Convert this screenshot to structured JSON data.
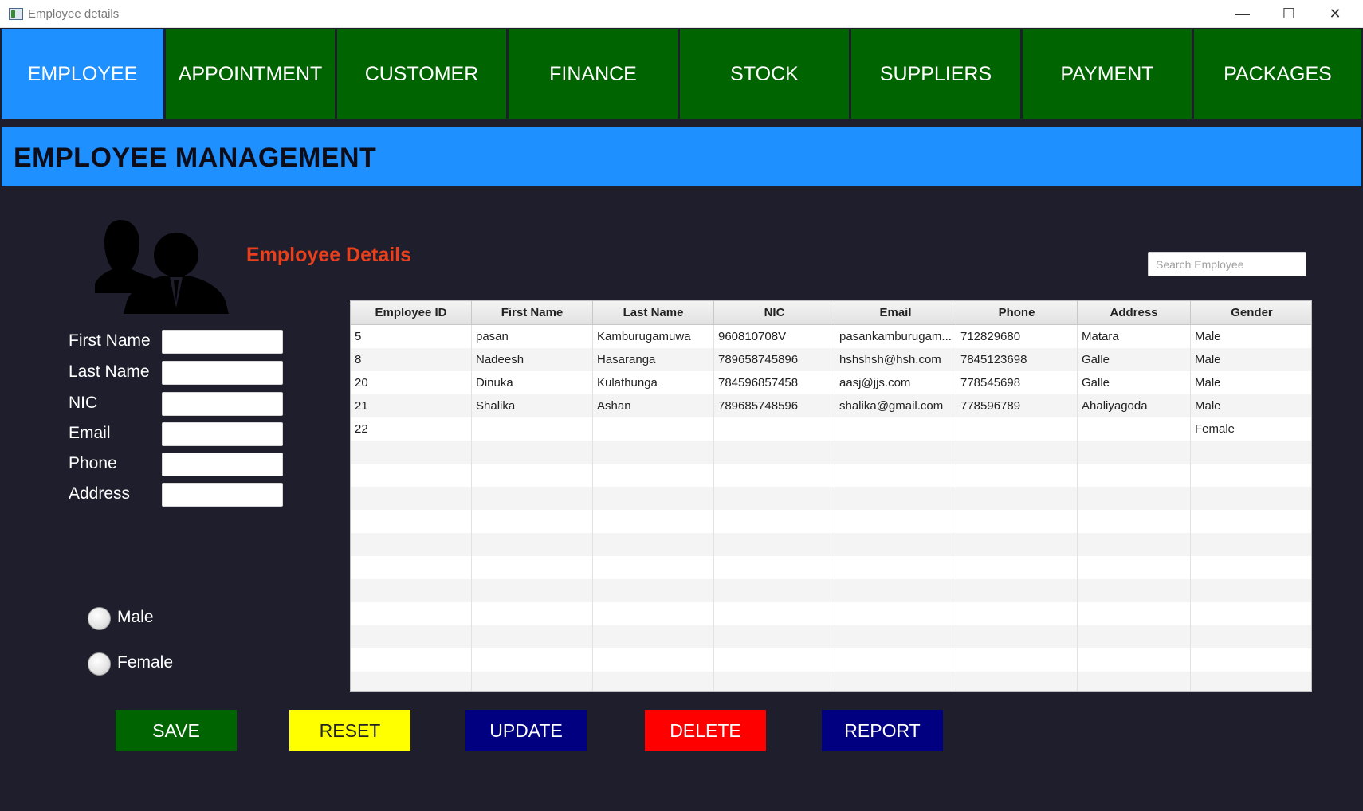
{
  "window": {
    "title": "Employee details",
    "minimize": "—",
    "maximize": "☐",
    "close": "✕"
  },
  "nav": {
    "items": [
      {
        "label": "EMPLOYEE",
        "active": true
      },
      {
        "label": "APPOINTMENT",
        "active": false
      },
      {
        "label": "CUSTOMER",
        "active": false
      },
      {
        "label": "FINANCE",
        "active": false
      },
      {
        "label": "STOCK",
        "active": false
      },
      {
        "label": "SUPPLIERS",
        "active": false
      },
      {
        "label": "PAYMENT",
        "active": false
      },
      {
        "label": "PACKAGES",
        "active": false
      }
    ]
  },
  "header": {
    "title": "EMPLOYEE MANAGEMENT"
  },
  "section": {
    "title": "Employee Details",
    "icon": "people-icon"
  },
  "search": {
    "placeholder": "Search Employee",
    "value": ""
  },
  "form": {
    "fields": [
      {
        "label": "First Name",
        "value": ""
      },
      {
        "label": "Last Name",
        "value": ""
      },
      {
        "label": "NIC",
        "value": ""
      },
      {
        "label": "Email",
        "value": ""
      },
      {
        "label": "Phone",
        "value": ""
      },
      {
        "label": "Address",
        "value": ""
      }
    ],
    "gender": [
      {
        "label": "Male",
        "checked": false
      },
      {
        "label": "Female",
        "checked": false
      }
    ]
  },
  "table": {
    "columns": [
      "Employee ID",
      "First Name",
      "Last Name",
      "NIC",
      "Email",
      "Phone",
      "Address",
      "Gender"
    ],
    "rows": [
      [
        "5",
        "pasan",
        "Kamburugamuwa",
        "960810708V",
        "pasankamburugam...",
        "712829680",
        "Matara",
        "Male"
      ],
      [
        "8",
        "Nadeesh",
        "Hasaranga",
        "789658745896",
        "hshshsh@hsh.com",
        "7845123698",
        "Galle",
        "Male"
      ],
      [
        "20",
        "Dinuka",
        "Kulathunga",
        "784596857458",
        "aasj@jjs.com",
        "778545698",
        "Galle",
        "Male"
      ],
      [
        "21",
        "Shalika",
        "Ashan",
        "789685748596",
        "shalika@gmail.com",
        "778596789",
        "Ahaliyagoda",
        "Male"
      ],
      [
        "22",
        "",
        "",
        "",
        "",
        "",
        "",
        "Female"
      ]
    ]
  },
  "buttons": {
    "save": "SAVE",
    "reset": "RESET",
    "update": "UPDATE",
    "delete": "DELETE",
    "report": "REPORT"
  },
  "colors": {
    "nav_bg": "#006400",
    "nav_active": "#1e90ff",
    "header_bg": "#1e90ff",
    "app_bg": "#1f1e2d",
    "section_title": "#e8401c",
    "save": "#006400",
    "reset": "#ffff00",
    "update": "#000080",
    "delete": "#ff0000",
    "report": "#000080"
  }
}
